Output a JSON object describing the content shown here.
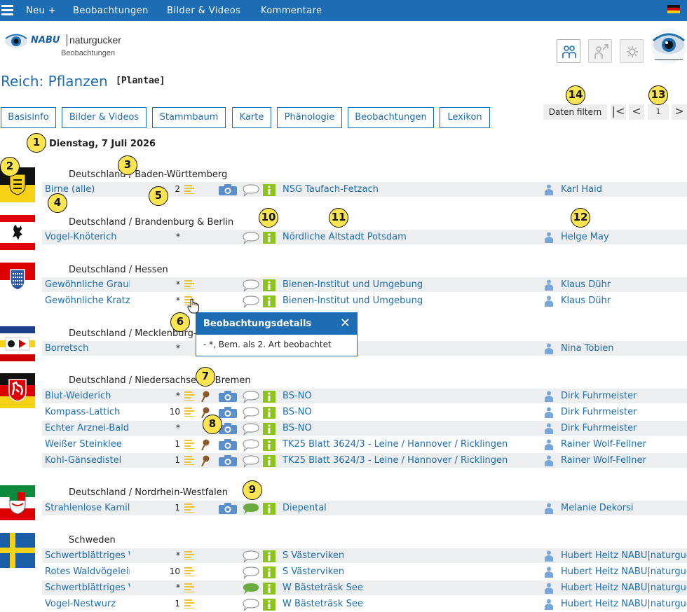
{
  "topbar": {
    "items": [
      "Neu +",
      "Beobachtungen",
      "Bilder & Videos",
      "Kommentare"
    ]
  },
  "logo": {
    "brand": "NABU",
    "name": "naturgucker",
    "sub": "Beobachtungen"
  },
  "header": {
    "title": "Reich: Pflanzen",
    "latin": "[Plantae]"
  },
  "tabs": [
    "Basisinfo",
    "Bilder & Videos",
    "Stammbaum",
    "Karte",
    "Phänologie",
    "Beobachtungen",
    "Lexikon"
  ],
  "filter_label": "Daten filtern",
  "pager": {
    "first": "|<",
    "prev": "<",
    "page": "1",
    "next": ">"
  },
  "date": "Dienstag, 7 Juli 2026",
  "regions": [
    {
      "name": "Deutschland / Baden-Württemberg",
      "flag": "baden-wuerttemberg"
    },
    {
      "name": "Deutschland / Brandenburg & Berlin",
      "flag": "berlin"
    },
    {
      "name": "Deutschland / Hessen",
      "flag": "hessen"
    },
    {
      "name": "Deutschland / Mecklenburg-Vorpommern",
      "flag": "mecklenburg-vorpommern"
    },
    {
      "name": "Deutschland / Niedersachsen & Bremen",
      "flag": "niedersachsen"
    },
    {
      "name": "Deutschland / Nordrhein-Westfalen",
      "flag": "nordrhein-westfalen"
    },
    {
      "name": "Schweden",
      "flag": "sweden"
    }
  ],
  "rows": [
    {
      "species": "Birne (alle)",
      "count": "2",
      "location": "NSG Taufach-Fetzach",
      "observer": "Karl Haid"
    },
    {
      "species": "Vogel-Knöterich",
      "count": "*",
      "location": "Nördliche Altstadt Potsdam",
      "observer": "Helge May"
    },
    {
      "species": "Gewöhnliche Graukresse",
      "count": "*",
      "location": "Bienen-Institut und Umgebung",
      "observer": "Klaus Dühr"
    },
    {
      "species": "Gewöhnliche Kratzdistel",
      "count": "*",
      "location": "Bienen-Institut und Umgebung",
      "observer": "Klaus Dühr"
    },
    {
      "species": "Borretsch",
      "count": "*",
      "location": "",
      "observer": "Nina Tobien"
    },
    {
      "species": "Blut-Weiderich",
      "count": "*",
      "location": "BS-NO",
      "observer": "Dirk Fuhrmeister"
    },
    {
      "species": "Kompass-Lattich",
      "count": "10",
      "location": "BS-NO",
      "observer": "Dirk Fuhrmeister"
    },
    {
      "species": "Echter Arznei-Baldrian",
      "count": "*",
      "location": "BS-NO",
      "observer": "Dirk Fuhrmeister"
    },
    {
      "species": "Weißer Steinklee",
      "count": "1",
      "location": "TK25 Blatt 3624/3 - Leine / Hannover / Ricklingen",
      "observer": "Rainer Wolf-Fellner"
    },
    {
      "species": "Kohl-Gänsedistel",
      "count": "1",
      "location": "TK25 Blatt 3624/3 - Leine / Hannover / Ricklingen",
      "observer": "Rainer Wolf-Fellner"
    },
    {
      "species": "Strahlenlose Kamille",
      "count": "1",
      "location": "Diepental",
      "observer": "Melanie Dekorsi"
    },
    {
      "species": "Schwertblättriges Waldvögelein",
      "count": "*",
      "location": "S Västerviken",
      "observer": "Hubert Heitz NABU|naturgucker"
    },
    {
      "species": "Rotes Waldvögelein",
      "count": "10",
      "location": "S Västerviken",
      "observer": "Hubert Heitz NABU|naturgucker"
    },
    {
      "species": "Schwertblättriges Waldvögelein",
      "count": "*",
      "location": "W Bästeträsk See",
      "observer": "Hubert Heitz NABU|naturgucker"
    },
    {
      "species": "Vogel-Nestwurz",
      "count": "1",
      "location": "W Bästeträsk See",
      "observer": "Hubert Heitz NABU|naturgucker"
    }
  ],
  "popup": {
    "title": "Beobachtungsdetails",
    "close": "✕",
    "text": "-  *, Bem. als 2. Art beobachtet"
  },
  "badges": [
    "1",
    "2",
    "3",
    "4",
    "5",
    "6",
    "7",
    "8",
    "9",
    "10",
    "11",
    "12",
    "13",
    "14"
  ],
  "colors": {
    "accent": "#1c6db3",
    "badge": "#fde552",
    "note": "#f2c12e",
    "pin": "#8a5a2b",
    "info": "#8dc21f",
    "camera": "#5b8fc9"
  }
}
